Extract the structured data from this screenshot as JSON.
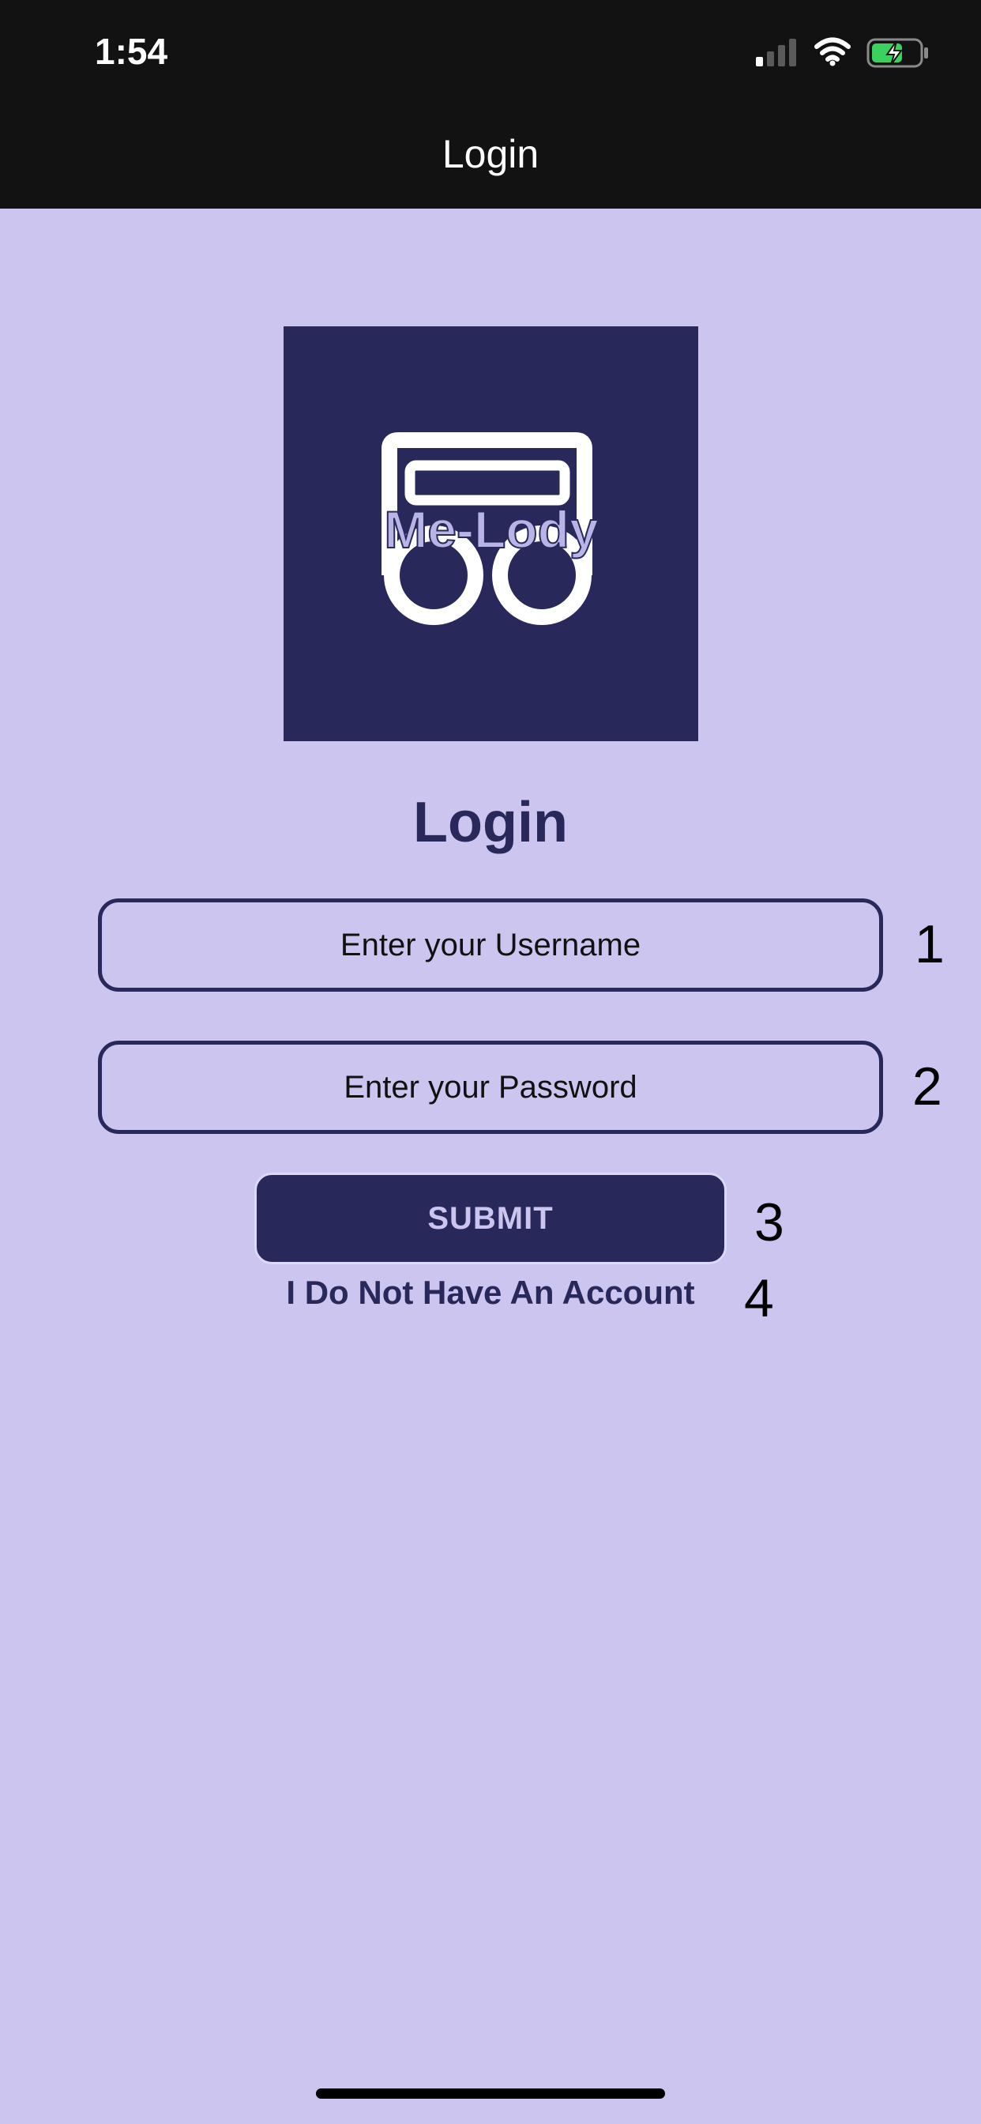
{
  "status_bar": {
    "time": "1:54",
    "icons": [
      "signal-icon",
      "wifi-icon",
      "battery-charging-icon"
    ]
  },
  "nav": {
    "title": "Login"
  },
  "logo": {
    "text": "Me-Lody",
    "icon": "music-note-icon",
    "colors": {
      "background": "#29285a",
      "outline": "#ffffff"
    }
  },
  "form": {
    "heading": "Login",
    "username_placeholder": "Enter your Username",
    "password_placeholder": "Enter your Password",
    "submit_label": "SUBMIT",
    "no_account_label": "I Do Not Have An Account"
  },
  "markers": [
    "1",
    "2",
    "3",
    "4"
  ],
  "colors": {
    "background": "#cbc5f0",
    "primary": "#29285a",
    "bar": "#121212"
  }
}
